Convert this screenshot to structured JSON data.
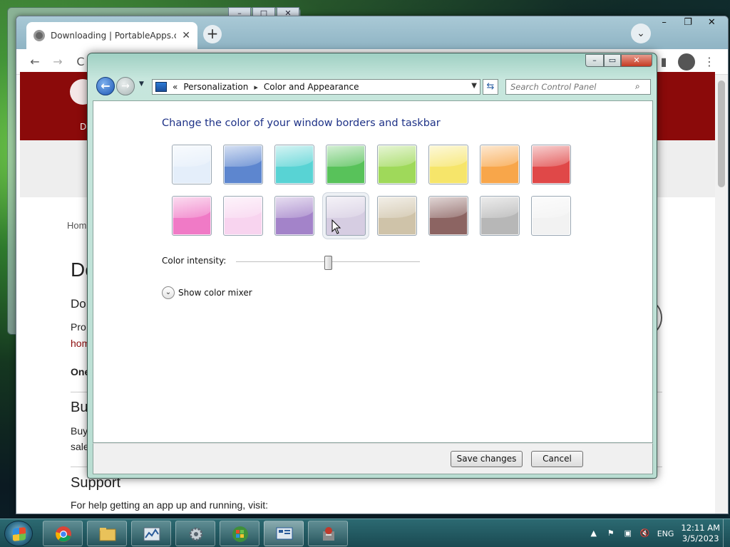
{
  "background_window": {
    "controls": [
      "–",
      "□",
      "✕"
    ]
  },
  "browser": {
    "tab_title": "Downloading | PortableApps.com",
    "tab_close": "✕",
    "new_tab": "+",
    "tab_search": "⌄",
    "window_controls": [
      "–",
      "❐",
      "✕"
    ],
    "back": "←",
    "forward": "→",
    "reload": "C",
    "menu": "⋮"
  },
  "page": {
    "nav_label": "Do",
    "breadcrumb": "Home",
    "heading": "Do",
    "subheading": "Do",
    "para1": "Pro",
    "para1_link": "hom",
    "bold_line": "One",
    "section_buy": "Bu",
    "buy_line1": "Buy",
    "buy_line2": "sale",
    "section_support": "Support",
    "support_text": "For help getting an app up and running, visit:"
  },
  "control_panel": {
    "window_controls": {
      "minimize": "–",
      "maximize": "▭",
      "close": "✕"
    },
    "breadcrumb": {
      "root": "«",
      "item1": "Personalization",
      "separator": "▸",
      "item2": "Color and Appearance"
    },
    "search_placeholder": "Search Control Panel",
    "heading": "Change the color of your window borders and taskbar",
    "swatches_row1": [
      {
        "name": "sky",
        "color": "#e4eefa"
      },
      {
        "name": "twilight",
        "color": "#5d86cf"
      },
      {
        "name": "sea",
        "color": "#58d3d4"
      },
      {
        "name": "leaf",
        "color": "#58c25a"
      },
      {
        "name": "lime",
        "color": "#9fd95a"
      },
      {
        "name": "sun",
        "color": "#f6e56a"
      },
      {
        "name": "pumpkin",
        "color": "#f8a64a"
      },
      {
        "name": "ruby",
        "color": "#e04848"
      }
    ],
    "swatches_row2": [
      {
        "name": "fuchsia",
        "color": "#f07ac6"
      },
      {
        "name": "blush",
        "color": "#f8d4ef"
      },
      {
        "name": "violet",
        "color": "#a383c9"
      },
      {
        "name": "lavender",
        "color": "#d6cde2"
      },
      {
        "name": "taupe",
        "color": "#cfc3a9"
      },
      {
        "name": "chocolate",
        "color": "#8c6462"
      },
      {
        "name": "slate",
        "color": "#b7b7b7"
      },
      {
        "name": "frost",
        "color": "#f2f2f2"
      }
    ],
    "hovered_swatch_index": 11,
    "intensity_label": "Color intensity:",
    "intensity_value": 0.5,
    "mixer_label": "Show color mixer",
    "save_label": "Save changes",
    "cancel_label": "Cancel"
  },
  "taskbar": {
    "language": "ENG",
    "time": "12:11 AM",
    "date": "3/5/2023",
    "tray_icons": [
      "▲",
      "⚑",
      "▣",
      "🔇"
    ]
  }
}
